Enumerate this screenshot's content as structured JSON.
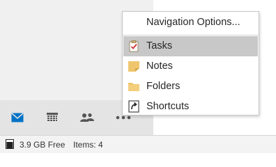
{
  "menu": {
    "header": "Navigation Options...",
    "items": [
      {
        "label": "Tasks",
        "icon": "tasks-icon",
        "active": true
      },
      {
        "label": "Notes",
        "icon": "notes-icon",
        "active": false
      },
      {
        "label": "Folders",
        "icon": "folder-icon",
        "active": false
      },
      {
        "label": "Shortcuts",
        "icon": "shortcuts-icon",
        "active": false
      }
    ]
  },
  "navbar": {
    "buttons": [
      {
        "icon": "mail-icon",
        "color": "#0072c6"
      },
      {
        "icon": "calendar-icon",
        "color": "#555555"
      },
      {
        "icon": "people-icon",
        "color": "#555555"
      },
      {
        "icon": "more-icon",
        "color": "#555555"
      }
    ]
  },
  "status": {
    "storage": "3.9 GB Free",
    "items": "Items: 4"
  }
}
